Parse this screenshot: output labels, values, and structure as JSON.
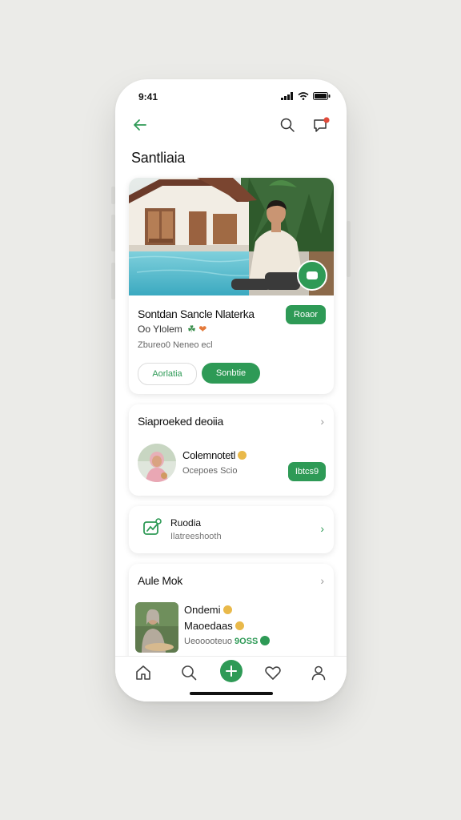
{
  "status": {
    "time": "9:41"
  },
  "header": {
    "title": "Santliaia"
  },
  "profile_card": {
    "name": "Sontdan Sancle Nlaterka",
    "subtitle": "Oo Ylolem",
    "meta": "Zbureo0 Neneo ecl",
    "follow_label": "Roaor",
    "outline_button_label": "Aorlatia",
    "primary_button_label": "Sonbtie"
  },
  "suggested": {
    "title": "Siaproeked deoiia",
    "person": {
      "name": "Colemnotetl",
      "subtitle": "Ocepoes Scio",
      "button_label": "Ibtcs9"
    }
  },
  "activity": {
    "title": "Ruodia",
    "subtitle": "Ilatreeshooth"
  },
  "more": {
    "title": "Aule Mok",
    "line1": "Ondemi",
    "line2": "Maoedaas",
    "line3_prefix": "Ueooooteuo",
    "line3_highlight": "9OSS"
  },
  "colors": {
    "accent": "#2e9a56",
    "background": "#ebebe8",
    "card": "#ffffff"
  },
  "icons": [
    "back-arrow-icon",
    "search-icon",
    "chat-icon",
    "home-icon",
    "search-icon",
    "plus-icon",
    "heart-icon",
    "profile-icon"
  ]
}
